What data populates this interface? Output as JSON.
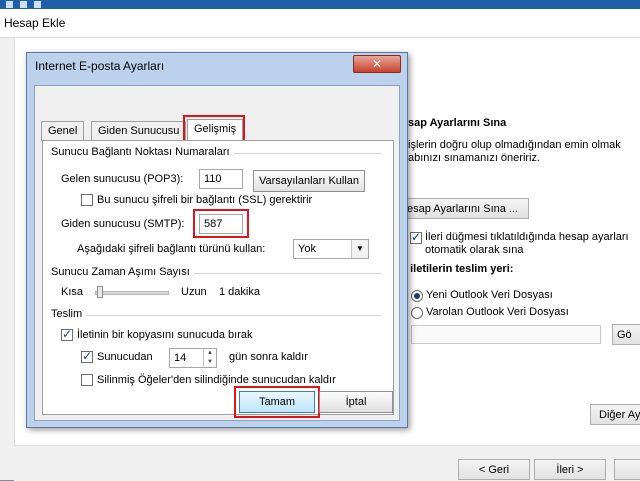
{
  "background_window": {
    "title": "Hesap Ekle",
    "test_heading": "sap Ayarlarını Sına",
    "test_desc_line1": "işlerin doğru olup olmadığından emin olmak",
    "test_desc_line2": "abınızı sınamanızı öneririz.",
    "test_button": "esap Ayarlarını Sına ...",
    "auto_test_label_line1": "İleri düğmesi tıklatıldığında hesap ayarları",
    "auto_test_label_line2": "otomatik olarak sına",
    "delivery_heading": "i iletilerin teslim yeri:",
    "radio_new": "Yeni Outlook Veri Dosyası",
    "radio_existing": "Varolan Outlook Veri Dosyası",
    "browse_button": "Gö",
    "other_settings_button": "Diğer Ay",
    "back_button": "< Geri",
    "next_button": "İleri >"
  },
  "dialog": {
    "title": "Internet E-posta Ayarları",
    "close": "✕",
    "tabs": [
      "Genel",
      "Giden Sunucusu",
      "Gelişmiş"
    ],
    "server_ports_group": "Sunucu Bağlantı Noktası Numaraları",
    "incoming_label": "Gelen sunucusu (POP3):",
    "incoming_port": "110",
    "defaults_button": "Varsayılanları Kullan",
    "ssl_label": "Bu sunucu şifreli bir bağlantı (SSL) gerektirir",
    "outgoing_label": "Giden sunucusu (SMTP):",
    "outgoing_port": "587",
    "encryption_label": "Aşağıdaki şifreli bağlantı türünü kullan:",
    "encryption_value": "Yok",
    "timeout_group": "Sunucu Zaman Aşımı Sayısı",
    "timeout_short": "Kısa",
    "timeout_long": "Uzun",
    "timeout_value": "1 dakika",
    "delivery_group": "Teslim",
    "leave_copy_label": "İletinin bir kopyasını sunucuda bırak",
    "remove_after_label": "Sunucudan",
    "remove_days": "14",
    "remove_after_suffix": "gün sonra kaldır",
    "remove_deleted_label": "Silinmiş Öğeler'den silindiğinde sunucudan kaldır",
    "ok_button": "Tamam",
    "cancel_button": "İptal"
  },
  "colors": {
    "highlight_red": "#e3131c",
    "dialog_frame": "#bcd1ec",
    "accent_blue": "#1f5ea8"
  }
}
